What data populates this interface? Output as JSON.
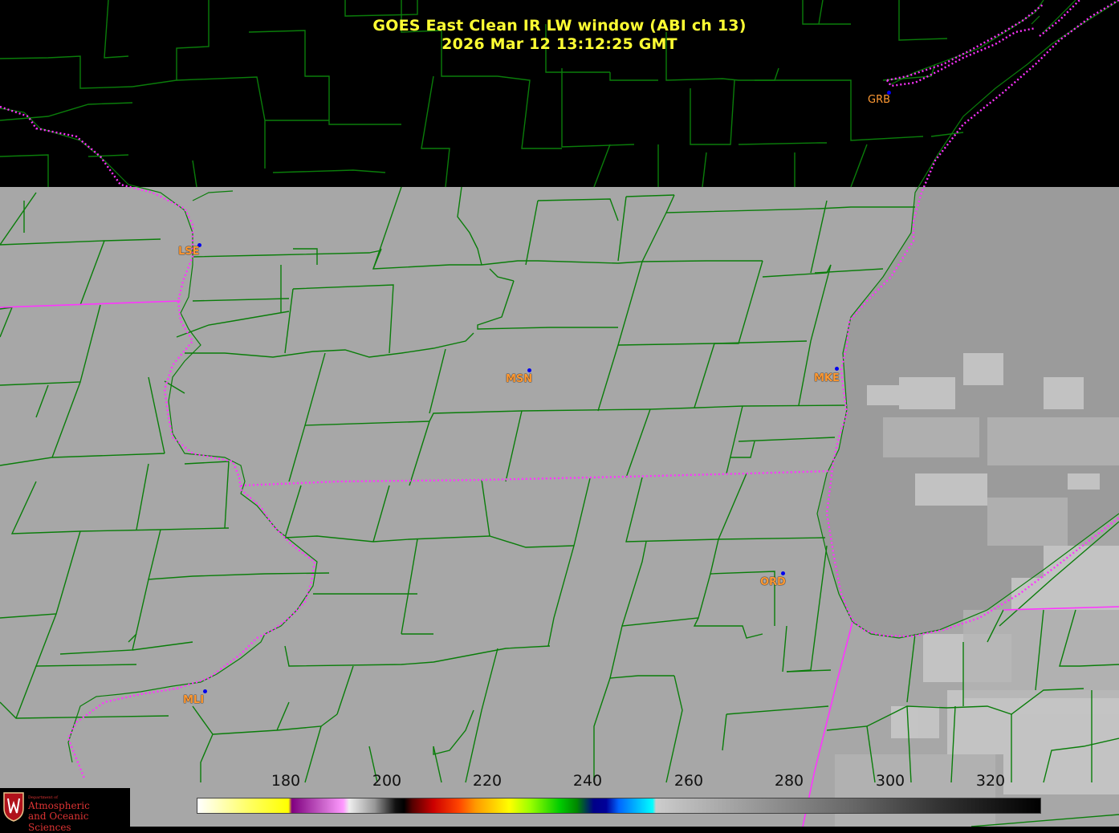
{
  "title": {
    "line1": "GOES East Clean IR LW window (ABI ch 13)",
    "line2": "2026 Mar 12  13:12:25 GMT"
  },
  "cities": [
    {
      "code": "GRB"
    },
    {
      "code": "LSE"
    },
    {
      "code": "MSN"
    },
    {
      "code": "MKE"
    },
    {
      "code": "ORD"
    },
    {
      "code": "MLI"
    }
  ],
  "colorbar": {
    "ticks": [
      "180",
      "200",
      "220",
      "240",
      "260",
      "280",
      "300",
      "320"
    ]
  },
  "logo": {
    "dept": "Department of",
    "line1": "Atmospheric",
    "line2": "and Oceanic Sciences"
  },
  "colors": {
    "title": "#ffff33",
    "county_lines": "#0a7d0a",
    "state_lines": "#ff33ff",
    "city_label": "#ff9933",
    "city_dot": "#0000ee",
    "land_gray": "#a6a6a6",
    "lake_gray": "#9a9a9a",
    "no_data": "#000000"
  }
}
